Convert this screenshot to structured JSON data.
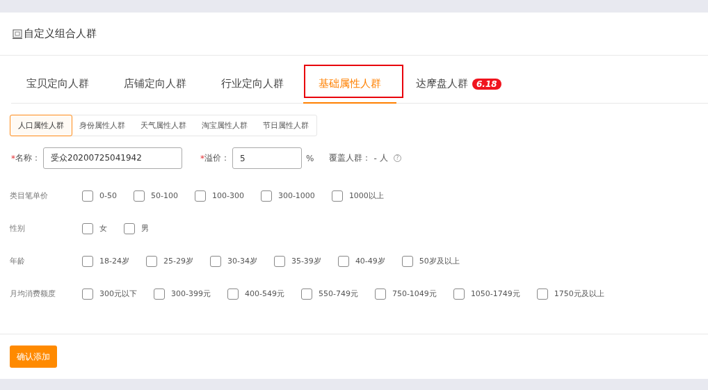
{
  "title": "自定义组合人群",
  "tabs": [
    {
      "label": "宝贝定向人群",
      "selected": false,
      "highlighted": false
    },
    {
      "label": "店铺定向人群",
      "selected": false,
      "highlighted": false
    },
    {
      "label": "行业定向人群",
      "selected": false,
      "highlighted": false
    },
    {
      "label": "基础属性人群",
      "selected": true,
      "highlighted": true
    },
    {
      "label": "达摩盘人群",
      "selected": false,
      "highlighted": false,
      "badge": "6.18"
    }
  ],
  "subtabs": [
    {
      "label": "人口属性人群",
      "selected": true
    },
    {
      "label": "身份属性人群",
      "selected": false
    },
    {
      "label": "天气属性人群",
      "selected": false
    },
    {
      "label": "淘宝属性人群",
      "selected": false
    },
    {
      "label": "节日属性人群",
      "selected": false
    }
  ],
  "form": {
    "required_mark": "*",
    "name_label": "名称：",
    "name_value": "受众20200725041942",
    "premium_label": "溢价：",
    "premium_value": "5",
    "premium_unit": "%",
    "coverage_label": "覆盖人群：",
    "coverage_value": "-",
    "coverage_unit": "人",
    "help": "?"
  },
  "groups": [
    {
      "label": "类目笔单价",
      "options": [
        {
          "label": "0-50",
          "checked": false
        },
        {
          "label": "50-100",
          "checked": false
        },
        {
          "label": "100-300",
          "checked": false
        },
        {
          "label": "300-1000",
          "checked": false
        },
        {
          "label": "1000以上",
          "checked": false
        }
      ]
    },
    {
      "label": "性别",
      "options": [
        {
          "label": "女",
          "checked": false
        },
        {
          "label": "男",
          "checked": false
        }
      ]
    },
    {
      "label": "年龄",
      "options": [
        {
          "label": "18-24岁",
          "checked": false
        },
        {
          "label": "25-29岁",
          "checked": false
        },
        {
          "label": "30-34岁",
          "checked": false
        },
        {
          "label": "35-39岁",
          "checked": false
        },
        {
          "label": "40-49岁",
          "checked": false
        },
        {
          "label": "50岁及以上",
          "checked": false
        }
      ]
    },
    {
      "label": "月均消费额度",
      "options": [
        {
          "label": "300元以下",
          "checked": false
        },
        {
          "label": "300-399元",
          "checked": false
        },
        {
          "label": "400-549元",
          "checked": false
        },
        {
          "label": "550-749元",
          "checked": false
        },
        {
          "label": "750-1049元",
          "checked": false
        },
        {
          "label": "1050-1749元",
          "checked": false
        },
        {
          "label": "1750元及以上",
          "checked": false
        }
      ]
    }
  ],
  "submit": "确认添加"
}
